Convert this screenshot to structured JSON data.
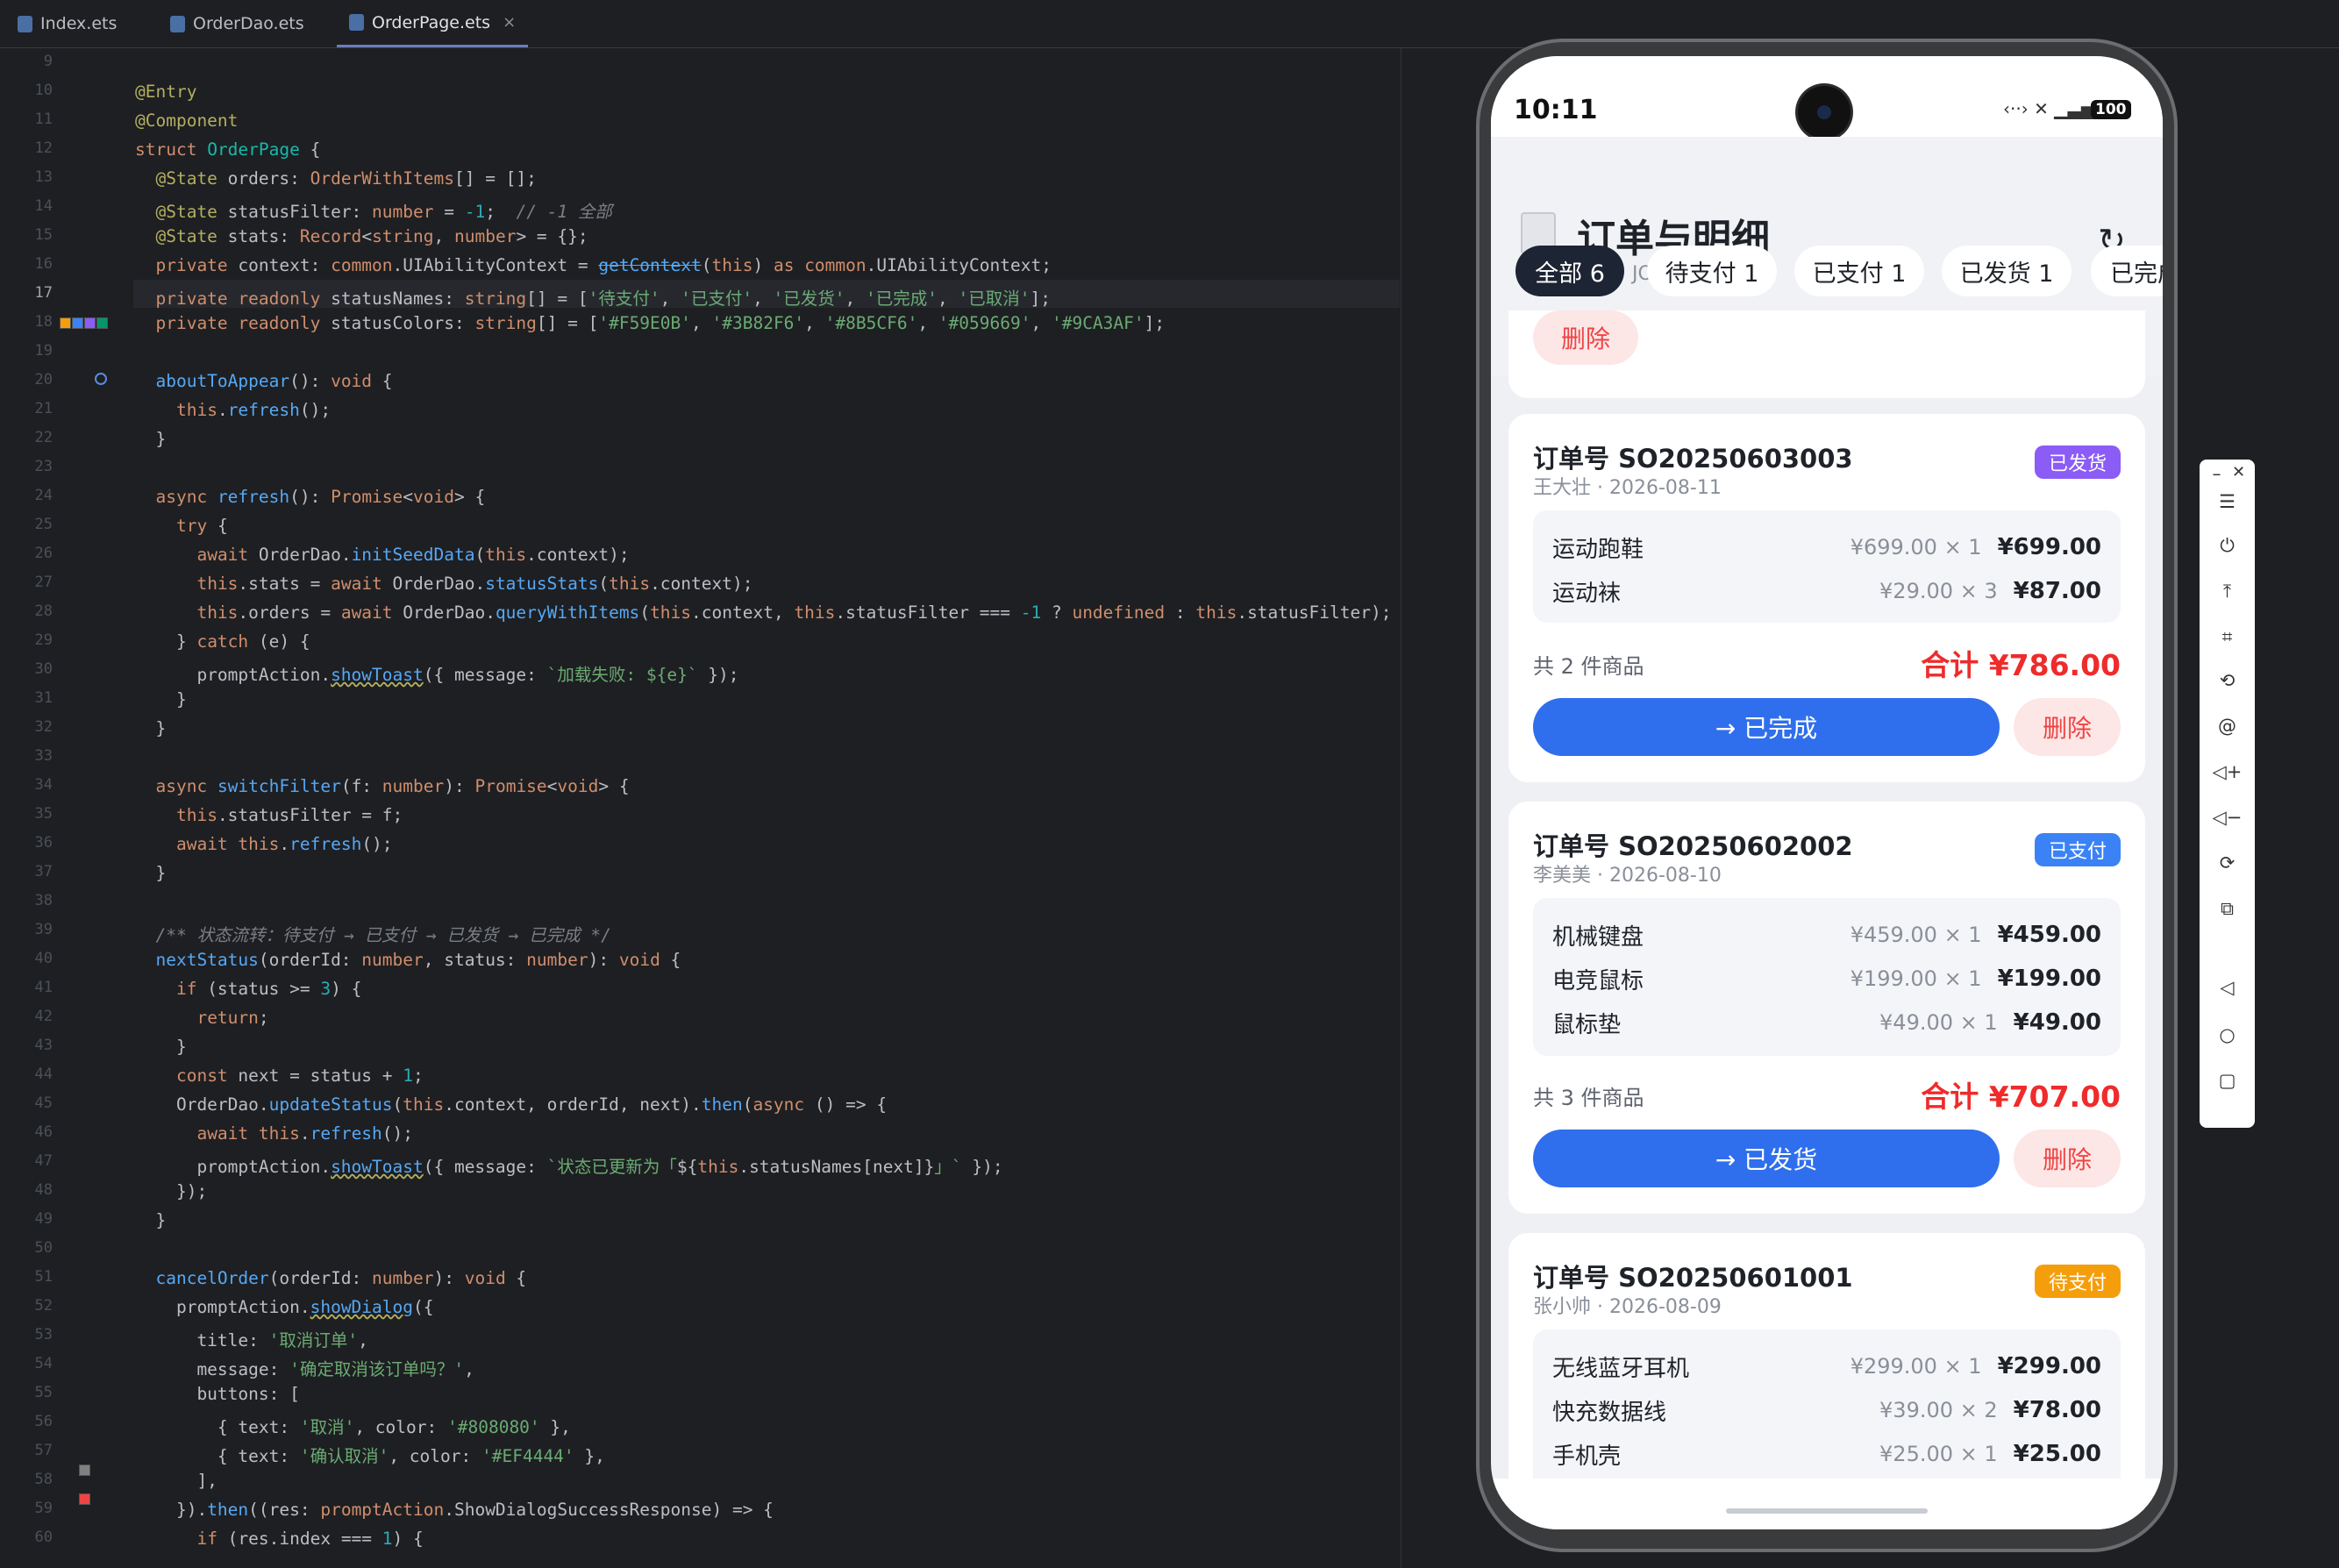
{
  "tabs": [
    {
      "label": "Index.ets",
      "active": false
    },
    {
      "label": "OrderDao.ets",
      "active": false
    },
    {
      "label": "OrderPage.ets",
      "active": true
    }
  ],
  "tab_close_icon": "×",
  "editor": {
    "line_numbers": [
      "9",
      "10",
      "11",
      "12",
      "13",
      "14",
      "15",
      "16",
      "17",
      "18",
      "19",
      "20",
      "21",
      "22",
      "23",
      "24",
      "25",
      "26",
      "27",
      "28",
      "29",
      "30",
      "31",
      "32",
      "33",
      "34",
      "35",
      "36",
      "37",
      "38",
      "39",
      "40",
      "41",
      "42",
      "43",
      "44",
      "45",
      "46",
      "47",
      "48",
      "49",
      "50",
      "51",
      "52",
      "53",
      "54",
      "55",
      "56",
      "57",
      "58",
      "59",
      "60"
    ],
    "current_line": "17",
    "gutter_colors": [
      "#F59E0B",
      "#3B82F6",
      "#8B5CF6",
      "#059669"
    ],
    "dialog_colors": [
      "#808080",
      "#EF4444"
    ]
  },
  "phone": {
    "time": "10:11",
    "status_icons": "‹··› ✕ ▁▃▅▇",
    "battery": "100",
    "header": {
      "title": "订单与明细",
      "subtitle": "外键一对多 · JOIN 联表查询",
      "refresh_icon": "↻",
      "receipt_icon": "receipt-icon"
    },
    "chips": [
      "全部 6",
      "待支付 1",
      "已支付 1",
      "已发货 1",
      "已完成"
    ],
    "partial_card": {
      "delete_label": "删除"
    },
    "orders": [
      {
        "order_no": "订单号 SO20250603003",
        "customer": "王大壮 · 2026-08-11",
        "status": "已发货",
        "status_color": "#8B5CF6",
        "items": [
          {
            "name": "运动跑鞋",
            "qty": "¥699.00 × 1",
            "total": "¥699.00"
          },
          {
            "name": "运动袜",
            "qty": "¥29.00 × 3",
            "total": "¥87.00"
          }
        ],
        "count": "共 2 件商品",
        "sum": "合计 ¥786.00",
        "action": "→ 已完成",
        "delete": "删除"
      },
      {
        "order_no": "订单号 SO20250602002",
        "customer": "李美美 · 2026-08-10",
        "status": "已支付",
        "status_color": "#3B82F6",
        "items": [
          {
            "name": "机械键盘",
            "qty": "¥459.00 × 1",
            "total": "¥459.00"
          },
          {
            "name": "电竞鼠标",
            "qty": "¥199.00 × 1",
            "total": "¥199.00"
          },
          {
            "name": "鼠标垫",
            "qty": "¥49.00 × 1",
            "total": "¥49.00"
          }
        ],
        "count": "共 3 件商品",
        "sum": "合计 ¥707.00",
        "action": "→ 已发货",
        "delete": "删除"
      },
      {
        "order_no": "订单号 SO20250601001",
        "customer": "张小帅 · 2026-08-09",
        "status": "待支付",
        "status_color": "#F59E0B",
        "items": [
          {
            "name": "无线蓝牙耳机",
            "qty": "¥299.00 × 1",
            "total": "¥299.00"
          },
          {
            "name": "快充数据线",
            "qty": "¥39.00 × 2",
            "total": "¥78.00"
          },
          {
            "name": "手机壳",
            "qty": "¥25.00 × 1",
            "total": "¥25.00"
          }
        ]
      }
    ]
  },
  "previewer_toolbar": {
    "minimize": "–",
    "close": "✕",
    "icons": [
      "menu-icon",
      "power-icon",
      "pin-top-icon",
      "crop-icon",
      "rotate-icon",
      "at-icon",
      "volume-up-icon",
      "volume-down-icon",
      "fold-icon",
      "multi-device-icon",
      "back-icon",
      "home-icon",
      "recent-icon"
    ]
  }
}
